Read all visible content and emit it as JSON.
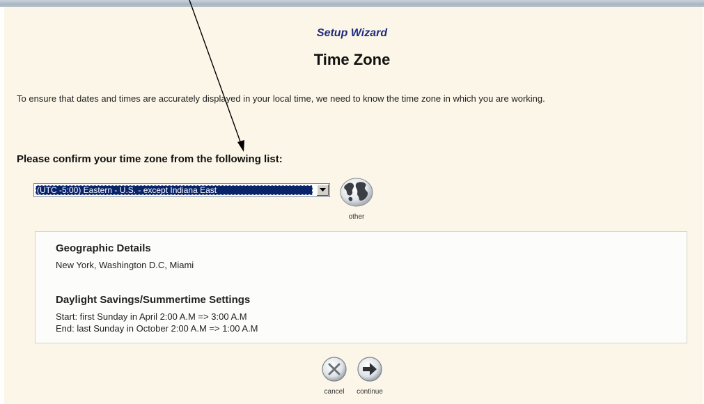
{
  "header": {
    "wizard_label": "Setup Wizard",
    "page_title": "Time Zone"
  },
  "intro_text": "To ensure that dates and times are accurately displayed in your local time, we need to know the time zone in which you are working.",
  "prompt": "Please confirm your time zone from the following list:",
  "timezone_select": {
    "selected_value": "(UTC -5:00) Eastern - U.S. - except Indiana East"
  },
  "other_button": {
    "label": "other",
    "icon": "globe-icon"
  },
  "details": {
    "geographic_heading": "Geographic Details",
    "geographic_cities": "New York, Washington D.C, Miami",
    "dst_heading": "Daylight Savings/Summertime Settings",
    "dst_start": "Start: first Sunday in April 2:00 A.M => 3:00 A.M",
    "dst_end": "End: last Sunday in October 2:00 A.M => 1:00 A.M"
  },
  "actions": {
    "cancel_label": "cancel",
    "continue_label": "continue"
  },
  "colors": {
    "panel_background": "#fbf6e7",
    "wizard_label": "#1f2a80",
    "selection_highlight": "#0a246a"
  }
}
